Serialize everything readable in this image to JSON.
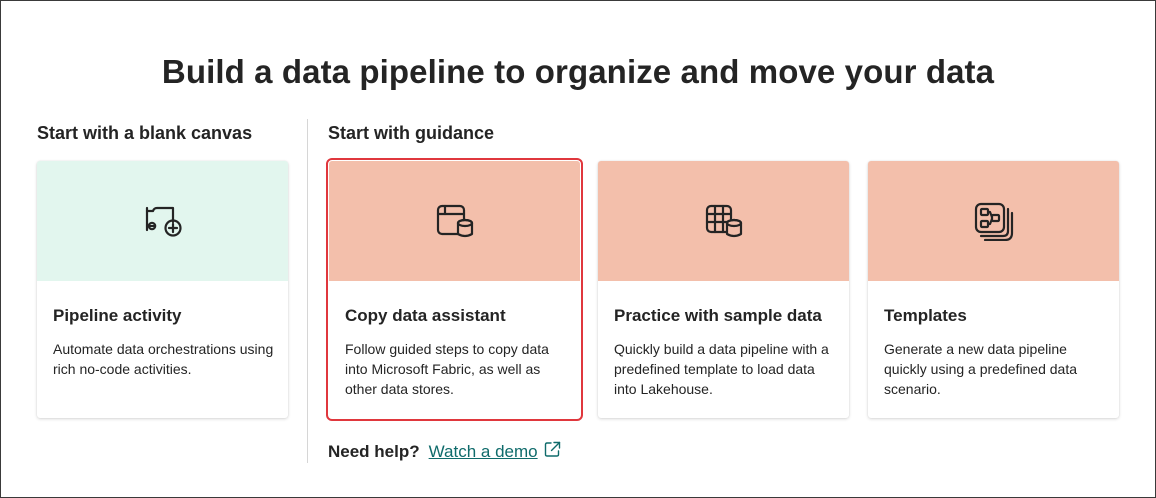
{
  "page": {
    "title": "Build a data pipeline to organize and move your data"
  },
  "sections": {
    "blank": {
      "heading": "Start with a blank canvas"
    },
    "guidance": {
      "heading": "Start with guidance"
    }
  },
  "cards": [
    {
      "title": "Pipeline activity",
      "description": "Automate data orchestrations using rich no-code activities.",
      "icon": "pipeline-add-icon",
      "banner_color": "#e2f6ee"
    },
    {
      "title": "Copy data assistant",
      "description": "Follow guided steps to copy data into Microsoft Fabric, as well as other data stores.",
      "icon": "copy-data-icon",
      "banner_color": "#f3bfab",
      "selected": true
    },
    {
      "title": "Practice with sample data",
      "description": "Quickly build a data pipeline with a predefined template to load data into Lakehouse.",
      "icon": "table-database-icon",
      "banner_color": "#f3bfab"
    },
    {
      "title": "Templates",
      "description": "Generate a new data pipeline quickly using a predefined data scenario.",
      "icon": "template-flow-icon",
      "banner_color": "#f3bfab"
    }
  ],
  "help": {
    "label": "Need help?",
    "link_text": "Watch a demo"
  },
  "colors": {
    "selected_outline": "#e0373d",
    "link": "#0f6b6b"
  }
}
